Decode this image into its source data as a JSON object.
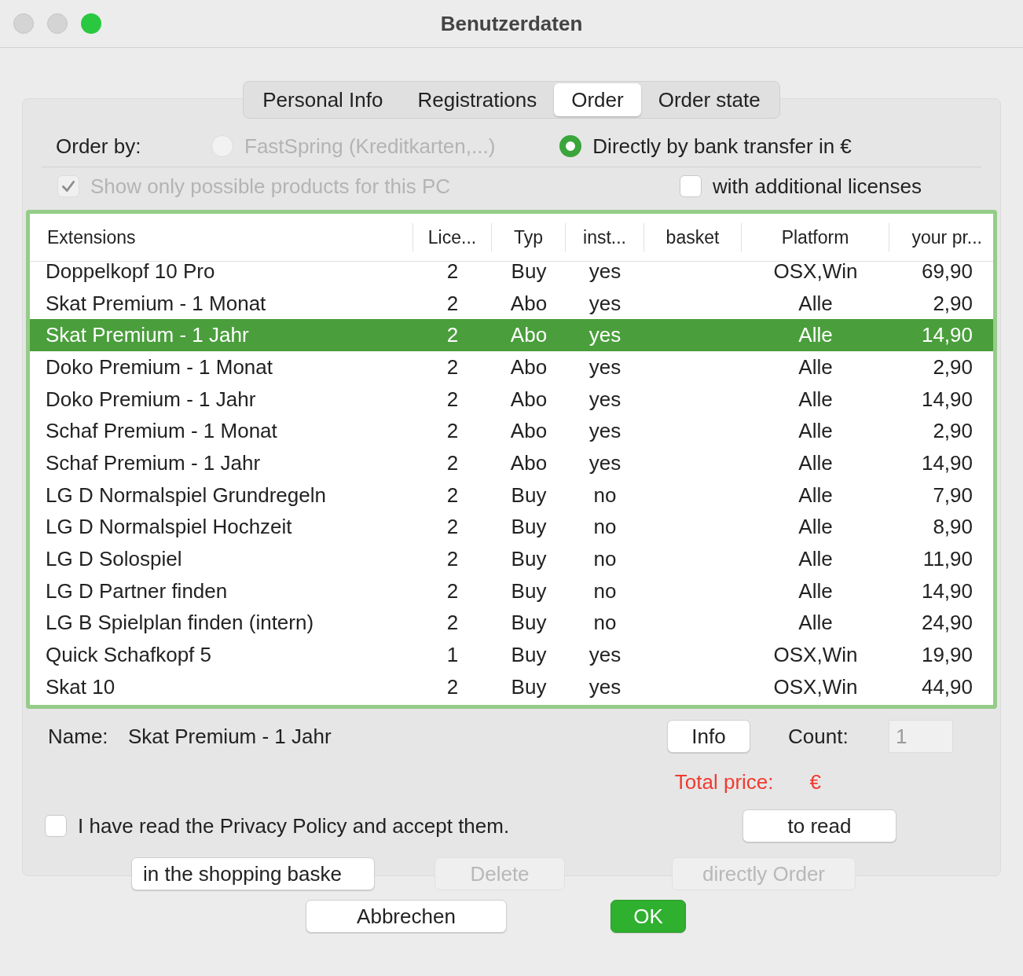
{
  "window": {
    "title": "Benutzerdaten"
  },
  "tabs": [
    {
      "label": "Personal Info",
      "selected": false
    },
    {
      "label": "Registrations",
      "selected": false
    },
    {
      "label": "Order",
      "selected": true
    },
    {
      "label": "Order state",
      "selected": false
    }
  ],
  "order_by": {
    "label": "Order by:",
    "options": [
      {
        "label": "FastSpring (Kreditkarten,...)",
        "selected": false,
        "disabled": true
      },
      {
        "label": "Directly by bank transfer in €",
        "selected": true,
        "disabled": false
      }
    ]
  },
  "filters": [
    {
      "label": "Show only possible products for this PC",
      "checked": true,
      "disabled": true
    },
    {
      "label": "with additional licenses",
      "checked": false,
      "disabled": false
    }
  ],
  "table": {
    "columns": [
      "Extensions",
      "Lice...",
      "Typ",
      "inst...",
      "basket",
      "Platform",
      "your pr..."
    ],
    "rows": [
      {
        "cells": [
          "Doppelkopf 10 Pro",
          "2",
          "Buy",
          "yes",
          "",
          "OSX,Win",
          "69,90"
        ],
        "selected": false
      },
      {
        "cells": [
          "Skat Premium - 1 Monat",
          "2",
          "Abo",
          "yes",
          "",
          "Alle",
          "2,90"
        ],
        "selected": false
      },
      {
        "cells": [
          "Skat Premium - 1 Jahr",
          "2",
          "Abo",
          "yes",
          "",
          "Alle",
          "14,90"
        ],
        "selected": true
      },
      {
        "cells": [
          "Doko Premium - 1 Monat",
          "2",
          "Abo",
          "yes",
          "",
          "Alle",
          "2,90"
        ],
        "selected": false
      },
      {
        "cells": [
          "Doko Premium - 1 Jahr",
          "2",
          "Abo",
          "yes",
          "",
          "Alle",
          "14,90"
        ],
        "selected": false
      },
      {
        "cells": [
          "Schaf Premium - 1 Monat",
          "2",
          "Abo",
          "yes",
          "",
          "Alle",
          "2,90"
        ],
        "selected": false
      },
      {
        "cells": [
          "Schaf Premium - 1 Jahr",
          "2",
          "Abo",
          "yes",
          "",
          "Alle",
          "14,90"
        ],
        "selected": false
      },
      {
        "cells": [
          "LG D Normalspiel Grundregeln",
          "2",
          "Buy",
          "no",
          "",
          "Alle",
          "7,90"
        ],
        "selected": false
      },
      {
        "cells": [
          "LG D Normalspiel Hochzeit",
          "2",
          "Buy",
          "no",
          "",
          "Alle",
          "8,90"
        ],
        "selected": false
      },
      {
        "cells": [
          "LG D Solospiel",
          "2",
          "Buy",
          "no",
          "",
          "Alle",
          "11,90"
        ],
        "selected": false
      },
      {
        "cells": [
          "LG D Partner finden",
          "2",
          "Buy",
          "no",
          "",
          "Alle",
          "14,90"
        ],
        "selected": false
      },
      {
        "cells": [
          "LG B Spielplan finden (intern)",
          "2",
          "Buy",
          "no",
          "",
          "Alle",
          "24,90"
        ],
        "selected": false
      },
      {
        "cells": [
          "Quick Schafkopf 5",
          "1",
          "Buy",
          "yes",
          "",
          "OSX,Win",
          "19,90"
        ],
        "selected": false
      },
      {
        "cells": [
          "Skat 10",
          "2",
          "Buy",
          "yes",
          "",
          "OSX,Win",
          "44,90"
        ],
        "selected": false
      }
    ]
  },
  "name": {
    "label": "Name:",
    "value": "Skat Premium - 1 Jahr"
  },
  "info_button": {
    "label": "Info"
  },
  "count": {
    "label": "Count:",
    "value": "1",
    "disabled": true
  },
  "total": {
    "label": "Total price:",
    "value": "€"
  },
  "privacy": {
    "label": "I have read the Privacy Policy and accept them.",
    "checked": false
  },
  "read_button": {
    "label": "to read"
  },
  "actions": [
    {
      "label": "in the shopping baske",
      "disabled": false
    },
    {
      "label": "Delete",
      "disabled": true
    },
    {
      "label": "directly Order",
      "disabled": true
    }
  ],
  "footer_buttons": [
    {
      "label": "Abbrechen",
      "kind": "plain"
    },
    {
      "label": "OK",
      "kind": "default"
    }
  ]
}
